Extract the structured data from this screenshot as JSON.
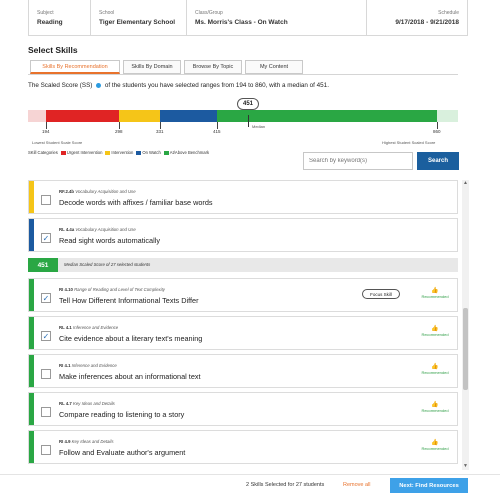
{
  "header": {
    "subject_label": "Subject",
    "subject": "Reading",
    "school_label": "School",
    "school": "Tiger Elementary School",
    "class_label": "Class/Group",
    "class_name": "Ms. Morris's Class - On Watch",
    "schedule_label": "Schedule",
    "schedule": "9/17/2018 - 9/21/2018"
  },
  "section_title": "Select Skills",
  "tabs": [
    "Skills By Recommendation",
    "Skills By Domain",
    "Browse By Topic",
    "My Content"
  ],
  "scaled_text_before": "The Scaled Score (SS)",
  "scaled_text_after": "of the students you have selected ranges from 194 to 860, with a median of 451.",
  "score_bar": {
    "median": "451",
    "median_label": "Median",
    "ticks": [
      "194",
      "298",
      "331",
      "415",
      "860"
    ],
    "lowest_label": "Lowest Student Scale Score",
    "highest_label": "Highest Student Scaled Score",
    "colors": {
      "urgent": "#e02424",
      "intervention": "#f5c518",
      "on_watch": "#1c5aa0",
      "at_above": "#2aa744",
      "fade_left": "#f6d4d4",
      "fade_right": "#d9f0dd"
    }
  },
  "legend": {
    "title": "SKill Categories",
    "items": [
      "Urgent Intervention",
      "Intervention",
      "On Watch",
      "At/Above Benchmark"
    ]
  },
  "search": {
    "placeholder": "Search by keyword(s)",
    "button": "Search"
  },
  "skills": [
    {
      "code": "RF.2.4b",
      "domain": "Vocabulary Acquisition and Use",
      "name": "Decode words with affixes / familiar base words",
      "checked": false,
      "accent": "#f5c518",
      "recommended": false
    },
    {
      "code": "RL 4.4a",
      "domain": "Vocabulary Acquisition and Use",
      "name": "Read sight words automatically",
      "checked": true,
      "accent": "#1c5aa0",
      "recommended": false
    },
    {
      "code": "RI 4.10",
      "domain": "Range of Reading and Level of Text Complexity",
      "name": "Tell How Different Informational Texts Differ",
      "checked": true,
      "accent": "#2aa744",
      "recommended": true,
      "focus": "Focus Skill"
    },
    {
      "code": "RL 4.1",
      "domain": "Inference and Evidence",
      "name": "Cite evidence about a literary text's meaning",
      "checked": true,
      "accent": "#2aa744",
      "recommended": true
    },
    {
      "code": "RI 4.1",
      "domain": "Inference and Evidence",
      "name": "Make inferences about an informational text",
      "checked": false,
      "accent": "#2aa744",
      "recommended": true
    },
    {
      "code": "RL 4.7",
      "domain": "Key Ideas and Details",
      "name": "Compare reading to listening to a story",
      "checked": false,
      "accent": "#2aa744",
      "recommended": true
    },
    {
      "code": "RI 4.9",
      "domain": "Key Ideas and Details",
      "name": "Follow and Evaluate author's argument",
      "checked": false,
      "accent": "#2aa744",
      "recommended": true
    }
  ],
  "recommended_label": "Recommended",
  "median_row": {
    "value": "451",
    "text": "Median Scaled Score of 27 selected students"
  },
  "footer": {
    "selected": "2 Skills Selected for 27 students",
    "remove": "Remove all",
    "next": "Next: Find Resources"
  }
}
